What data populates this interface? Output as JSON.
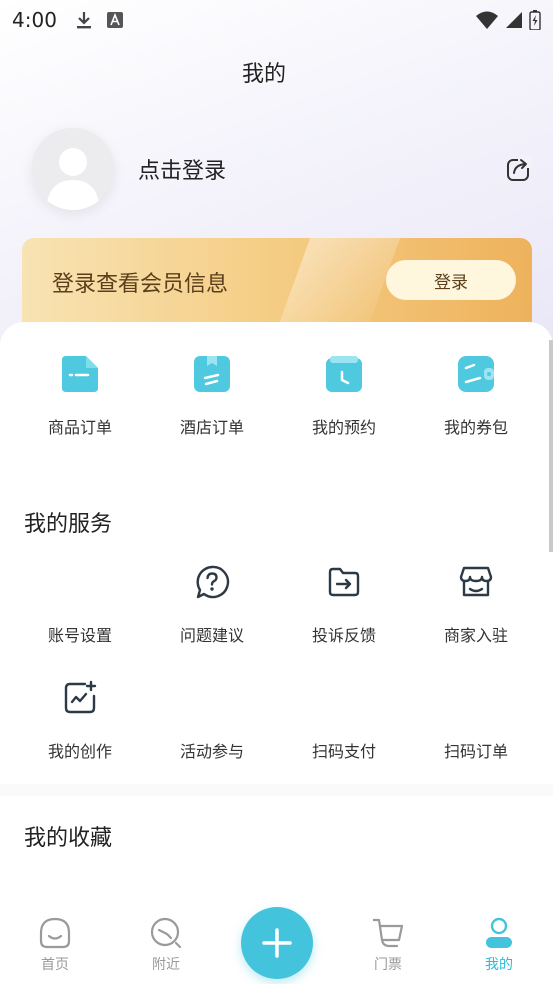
{
  "status_bar": {
    "time": "4:00"
  },
  "header": {
    "title": "我的"
  },
  "profile": {
    "login_text": "点击登录"
  },
  "member_card": {
    "text": "登录查看会员信息",
    "button": "登录"
  },
  "orders": [
    {
      "label": "商品订单",
      "icon": "product-order-icon"
    },
    {
      "label": "酒店订单",
      "icon": "hotel-order-icon"
    },
    {
      "label": "我的预约",
      "icon": "reservation-icon"
    },
    {
      "label": "我的券包",
      "icon": "coupon-wallet-icon"
    }
  ],
  "services": {
    "title": "我的服务",
    "items": [
      {
        "label": "账号设置",
        "icon": ""
      },
      {
        "label": "问题建议",
        "icon": "question-icon"
      },
      {
        "label": "投诉反馈",
        "icon": "feedback-folder-icon"
      },
      {
        "label": "商家入驻",
        "icon": "store-icon"
      },
      {
        "label": "我的创作",
        "icon": "creation-icon"
      },
      {
        "label": "活动参与",
        "icon": ""
      },
      {
        "label": "扫码支付",
        "icon": ""
      },
      {
        "label": "扫码订单",
        "icon": ""
      }
    ]
  },
  "favorites": {
    "title": "我的收藏"
  },
  "tabbar": {
    "tabs": [
      {
        "label": "首页",
        "icon": "home-icon"
      },
      {
        "label": "附近",
        "icon": "nearby-icon"
      },
      {
        "label": "门票",
        "icon": "ticket-cart-icon"
      },
      {
        "label": "我的",
        "icon": "profile-icon"
      }
    ],
    "active": "我的",
    "accent": "#43c4dc"
  }
}
